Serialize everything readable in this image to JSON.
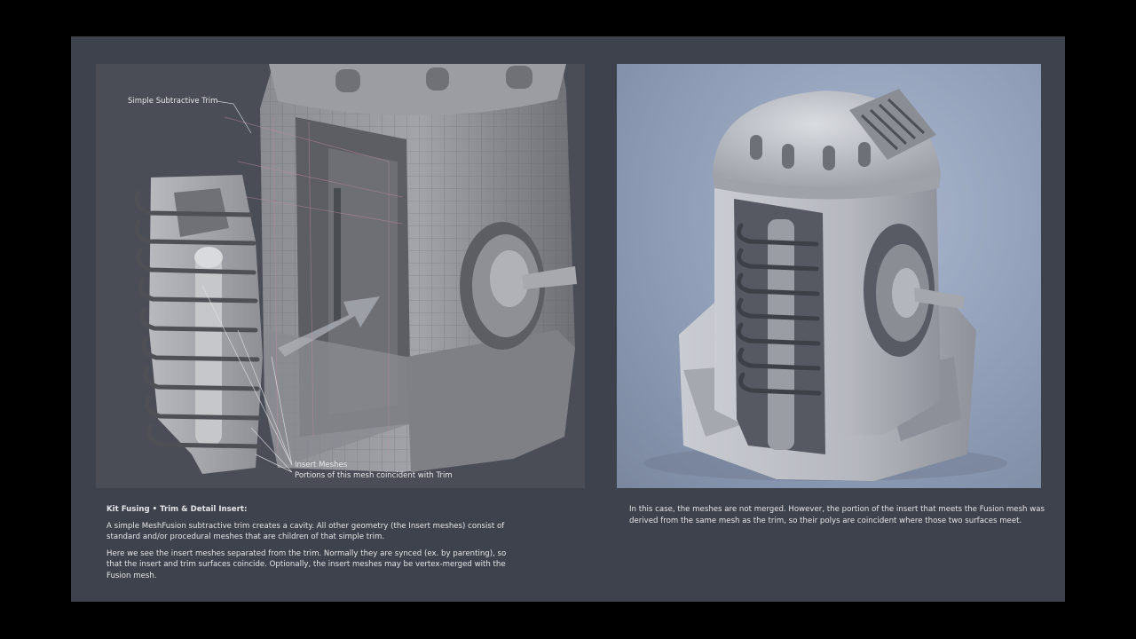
{
  "left_panel": {
    "callouts": {
      "trim": "Simple Subtractive Trim",
      "insert": "Insert Meshes",
      "portions": "Portions of this mesh coincident with Trim"
    }
  },
  "left_caption": {
    "title": "Kit Fusing  • Trim & Detail Insert:",
    "para1": "A simple MeshFusion subtractive trim creates a cavity. All other geometry (the Insert meshes) consist of standard and/or procedural meshes that are children of that simple trim.",
    "para2": "Here we see the insert meshes separated from the trim. Normally they are synced (ex. by parenting), so that the insert and trim surfaces coincide. Optionally, the insert meshes may be vertex-merged with the Fusion mesh."
  },
  "right_caption": {
    "para1": "In this case, the meshes are not merged. However, the portion of the insert that meets the Fusion mesh was derived from the same mesh as the trim, so their polys are coincident where those two surfaces meet."
  },
  "colors": {
    "page_background": "#000000",
    "slide_background": "#3e424c",
    "left_panel_background": "#4a4d56",
    "right_panel_background": "#94a2bb"
  }
}
